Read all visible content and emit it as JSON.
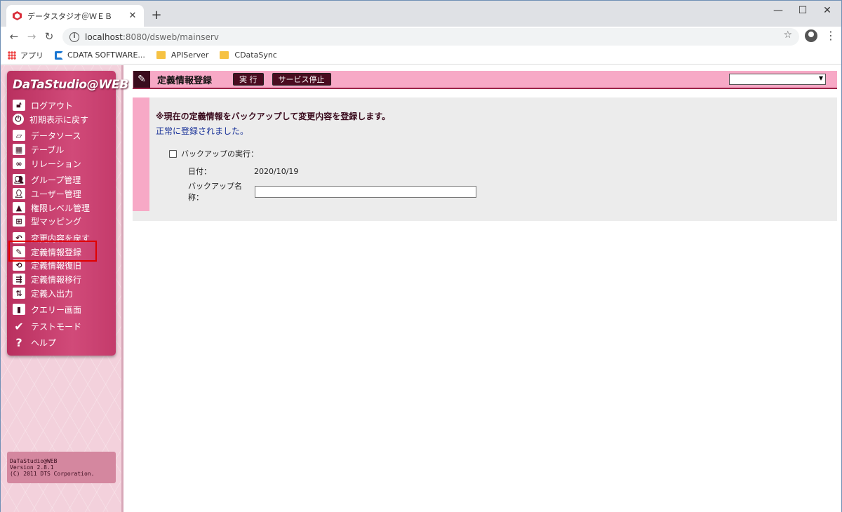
{
  "browser": {
    "tab_title": "データスタジオ＠ＷＥＢ",
    "url_host": "localhost",
    "url_rest": ":8080/dsweb/mainserv",
    "bookmarks": [
      "アプリ",
      "CDATA SOFTWARE...",
      "APIServer",
      "CDataSync"
    ]
  },
  "sidebar": {
    "logo": "DaTaStudio@WEB",
    "items": [
      {
        "label": "ログアウト",
        "icon": "lock-icon"
      },
      {
        "label": "初期表示に戻す",
        "icon": "power-icon"
      },
      {
        "label": "データソース",
        "icon": "folder-icon"
      },
      {
        "label": "テーブル",
        "icon": "grid-icon"
      },
      {
        "label": "リレーション",
        "icon": "link-icon"
      },
      {
        "label": "グループ管理",
        "icon": "group-icon"
      },
      {
        "label": "ユーザー管理",
        "icon": "user-icon"
      },
      {
        "label": "権限レベル管理",
        "icon": "pyramid-icon"
      },
      {
        "label": "型マッピング",
        "icon": "mapping-icon"
      },
      {
        "label": "変更内容を戻す",
        "icon": "undo-doc-icon"
      },
      {
        "label": "定義情報登録",
        "icon": "edit-icon"
      },
      {
        "label": "定義情報復旧",
        "icon": "restore-icon"
      },
      {
        "label": "定義情報移行",
        "icon": "migrate-icon"
      },
      {
        "label": "定義入出力",
        "icon": "import-export-icon"
      },
      {
        "label": "クエリー画面",
        "icon": "chart-icon"
      },
      {
        "label": "テストモード",
        "icon": "check-icon"
      },
      {
        "label": "ヘルプ",
        "icon": "help-icon"
      }
    ],
    "version_lines": [
      "DaTaStudio@WEB",
      "Version 2.8.1",
      "(C) 2011 DTS Corporation."
    ]
  },
  "header": {
    "title": "定義情報登録",
    "run_button": "実 行",
    "stop_button": "サービス停止",
    "select_value": ""
  },
  "panel": {
    "notice": "※現在の定義情報をバックアップして変更内容を登録します。",
    "success": "正常に登録されました。",
    "backup_label": "バックアップの実行：",
    "date_label": "日付：",
    "date_value": "2020/10/19",
    "name_label": "バックアップ名称：",
    "name_value": ""
  },
  "colors": {
    "accent": "#c43b6b",
    "header_bg": "#f7a9c6",
    "highlight_border": "#e00000"
  }
}
